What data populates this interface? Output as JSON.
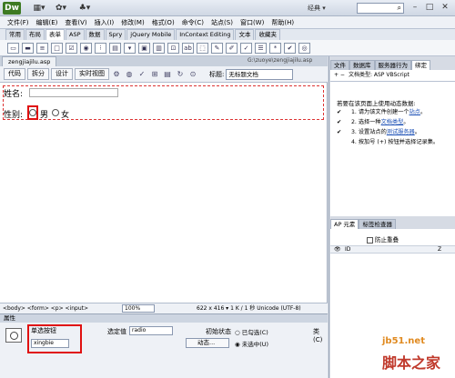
{
  "app": {
    "logo": "Dw",
    "workspace": "经典 ▾",
    "search_icon": "⌕"
  },
  "menu": [
    "文件(F)",
    "编辑(E)",
    "查看(V)",
    "插入(I)",
    "修改(M)",
    "格式(O)",
    "命令(C)",
    "站点(S)",
    "窗口(W)",
    "帮助(H)"
  ],
  "insert_tabs": [
    "常用",
    "布局",
    "表单",
    "ASP",
    "数据",
    "Spry",
    "jQuery Mobile",
    "InContext Editing",
    "文本",
    "收藏夹"
  ],
  "insert_active": "表单",
  "document": {
    "tab_name": "zengjiajilu.asp",
    "path": "G:\\zuoye\\zengjiajilu.asp",
    "view_buttons": [
      "代码",
      "拆分",
      "设计",
      "实时视图"
    ],
    "title_label": "标题:",
    "title_value": "无标题文档"
  },
  "form": {
    "name_label": "姓名:",
    "gender_label": "性别:",
    "male": "男",
    "female": "女"
  },
  "statusbar": {
    "tags": "<body> <form> <p> <input>",
    "zoom": "100%",
    "info": "622 x 416 ▾  1 K / 1 秒  Unicode (UTF-8)"
  },
  "properties": {
    "header": "属性",
    "type_label": "单选按钮",
    "name_value": "xingbie",
    "checked_label": "选定值",
    "checked_value": "radio",
    "init_label": "初始状态",
    "opt_checked": "○ 已勾选(C)",
    "opt_unchecked": "◉ 未选中(U)",
    "dynamic": "动态...",
    "class_label": "类(C)"
  },
  "right": {
    "tabs": [
      "文件",
      "数据库",
      "服务器行为",
      "绑定"
    ],
    "active_tab": "绑定",
    "doc_type": "文档类型: ASP VBScript",
    "bind_title": "若要在该页面上使用动态数据:",
    "steps": [
      {
        "check": "✔",
        "num": "1.",
        "text": "请为该文件创建一个",
        "link": "站点",
        "tail": "。"
      },
      {
        "check": "✔",
        "num": "2.",
        "text": "选择一种",
        "link": "文档类型",
        "tail": "。"
      },
      {
        "check": "✔",
        "num": "3.",
        "text": "设置站点的",
        "link": "测试服务器",
        "tail": "。"
      },
      {
        "check": "",
        "num": "4.",
        "text": "按加号 (+) 按钮并选择记录集。",
        "link": "",
        "tail": ""
      }
    ],
    "ap_tabs": [
      "AP 元素",
      "标签检查器"
    ],
    "ap_active": "AP 元素",
    "prevent_overlap": "防止重叠",
    "col_id": "ID",
    "col_z": "Z"
  },
  "watermark": {
    "line1": "jb51.net",
    "line2": "脚本之家"
  }
}
